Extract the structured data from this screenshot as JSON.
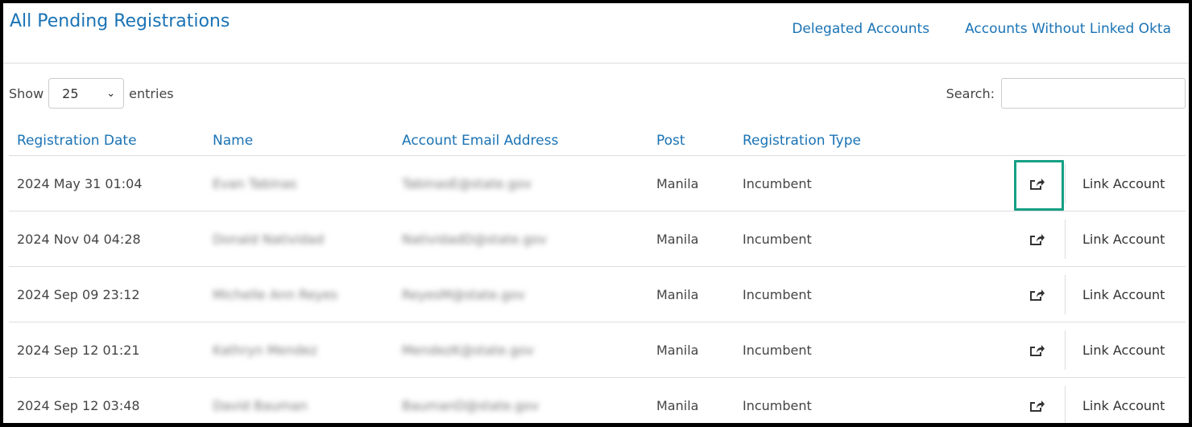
{
  "header": {
    "title": "All Pending Registrations",
    "links": [
      "Delegated Accounts",
      "Accounts Without Linked Okta"
    ]
  },
  "controls": {
    "show_label": "Show",
    "entries_value": "25",
    "entries_label": "entries",
    "search_label": "Search:",
    "search_value": ""
  },
  "table": {
    "columns": [
      "Registration Date",
      "Name",
      "Account Email Address",
      "Post",
      "Registration Type"
    ],
    "action_label": "Link Account",
    "rows": [
      {
        "date": "2024 May 31 01:04",
        "name": "Evan Tabinas",
        "email": "TabinasE@state.gov",
        "post": "Manila",
        "type": "Incumbent"
      },
      {
        "date": "2024 Nov 04 04:28",
        "name": "Donald Natividad",
        "email": "NatividadD@state.gov",
        "post": "Manila",
        "type": "Incumbent"
      },
      {
        "date": "2024 Sep 09 23:12",
        "name": "Michelle Ann Reyes",
        "email": "ReyesM@state.gov",
        "post": "Manila",
        "type": "Incumbent"
      },
      {
        "date": "2024 Sep 12 01:21",
        "name": "Kathryn Mendez",
        "email": "MendezK@state.gov",
        "post": "Manila",
        "type": "Incumbent"
      },
      {
        "date": "2024 Sep 12 03:48",
        "name": "David Bauman",
        "email": "BaumanD@state.gov",
        "post": "Manila",
        "type": "Incumbent"
      }
    ]
  },
  "highlight_color": "#16a085",
  "link_color": "#1a73b5"
}
